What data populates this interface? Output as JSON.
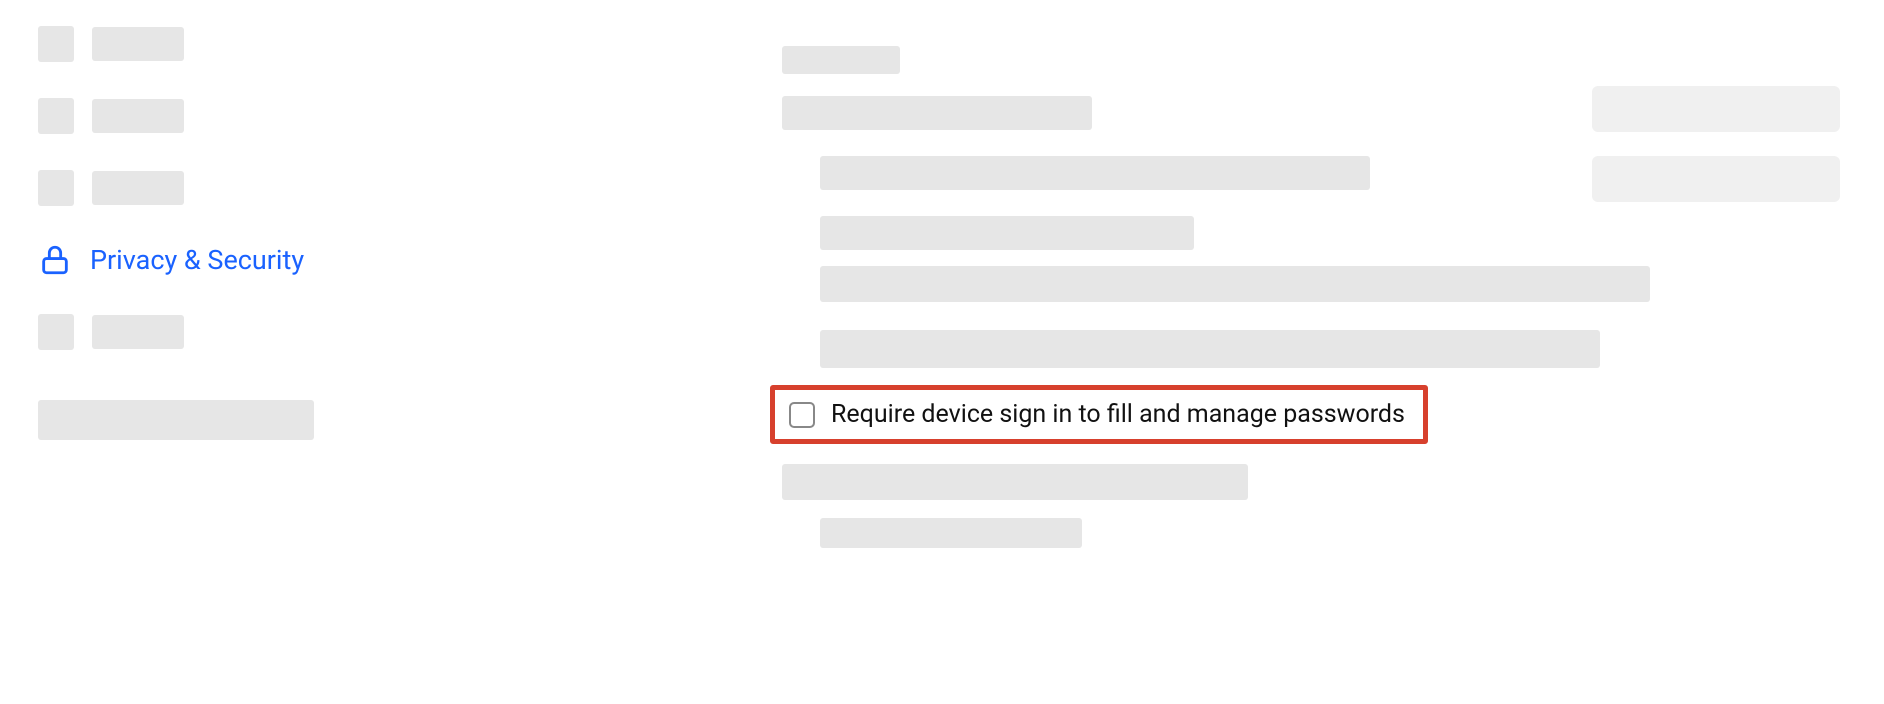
{
  "sidebar": {
    "active_item": {
      "label": "Privacy & Security",
      "icon": "lock-icon"
    }
  },
  "main": {
    "highlighted_checkbox_label": "Require device sign in to fill and manage passwords"
  },
  "colors": {
    "accent": "#1a62ff",
    "highlight_border": "#d7402d",
    "placeholder": "#e6e6e6"
  }
}
